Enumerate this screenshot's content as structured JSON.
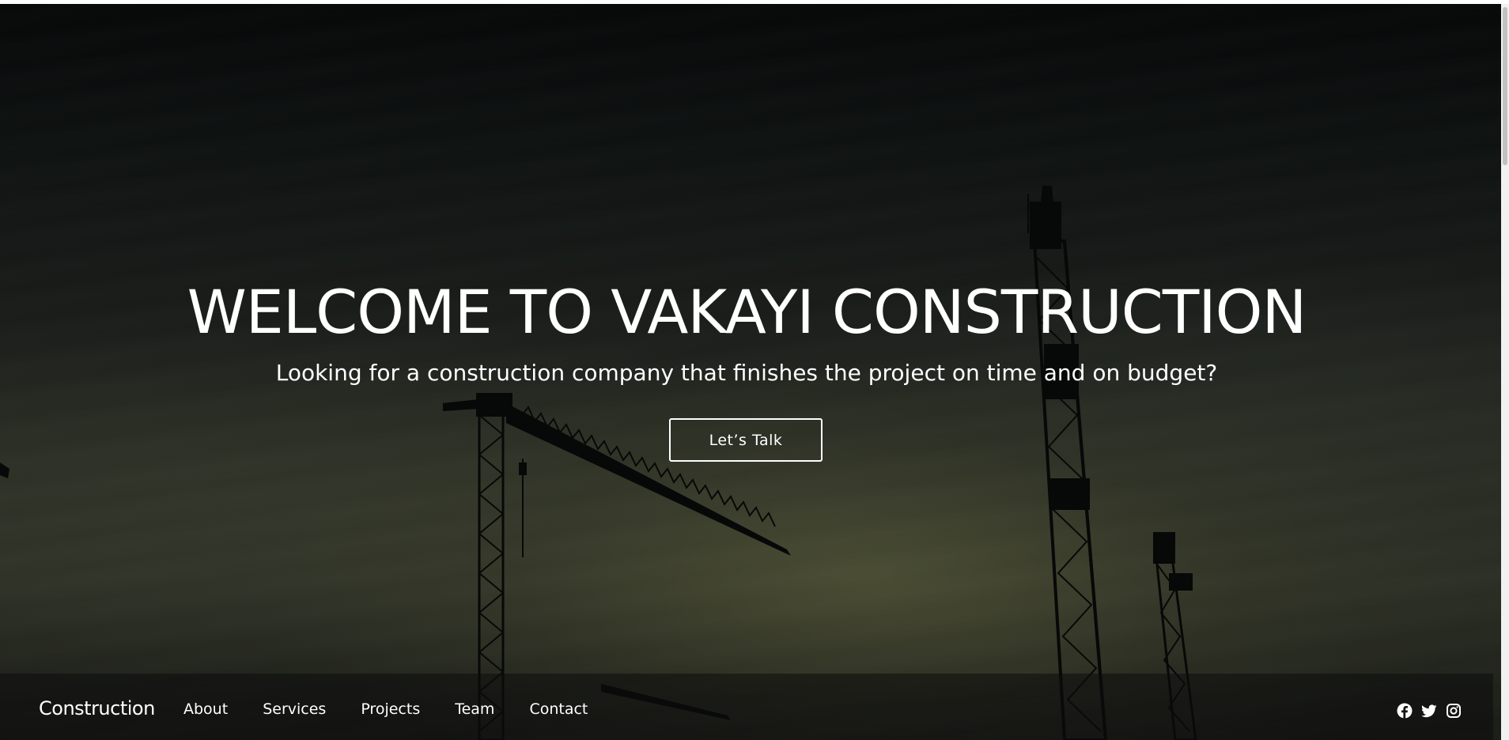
{
  "hero": {
    "title": "WELCOME TO VAKAYI CONSTRUCTION",
    "subtitle": "Looking for a construction company that finishes the project on time and on budget?",
    "cta_label": "Let’s Talk"
  },
  "navbar": {
    "brand": "Construction",
    "links": [
      {
        "label": "About"
      },
      {
        "label": "Services"
      },
      {
        "label": "Projects"
      },
      {
        "label": "Team"
      },
      {
        "label": "Contact"
      }
    ],
    "social": [
      {
        "icon": "facebook-icon"
      },
      {
        "icon": "twitter-icon"
      },
      {
        "icon": "instagram-icon"
      }
    ]
  },
  "colors": {
    "text": "#ffffff",
    "background": "#0b0d0d",
    "navbar": "#0c0c0c"
  }
}
